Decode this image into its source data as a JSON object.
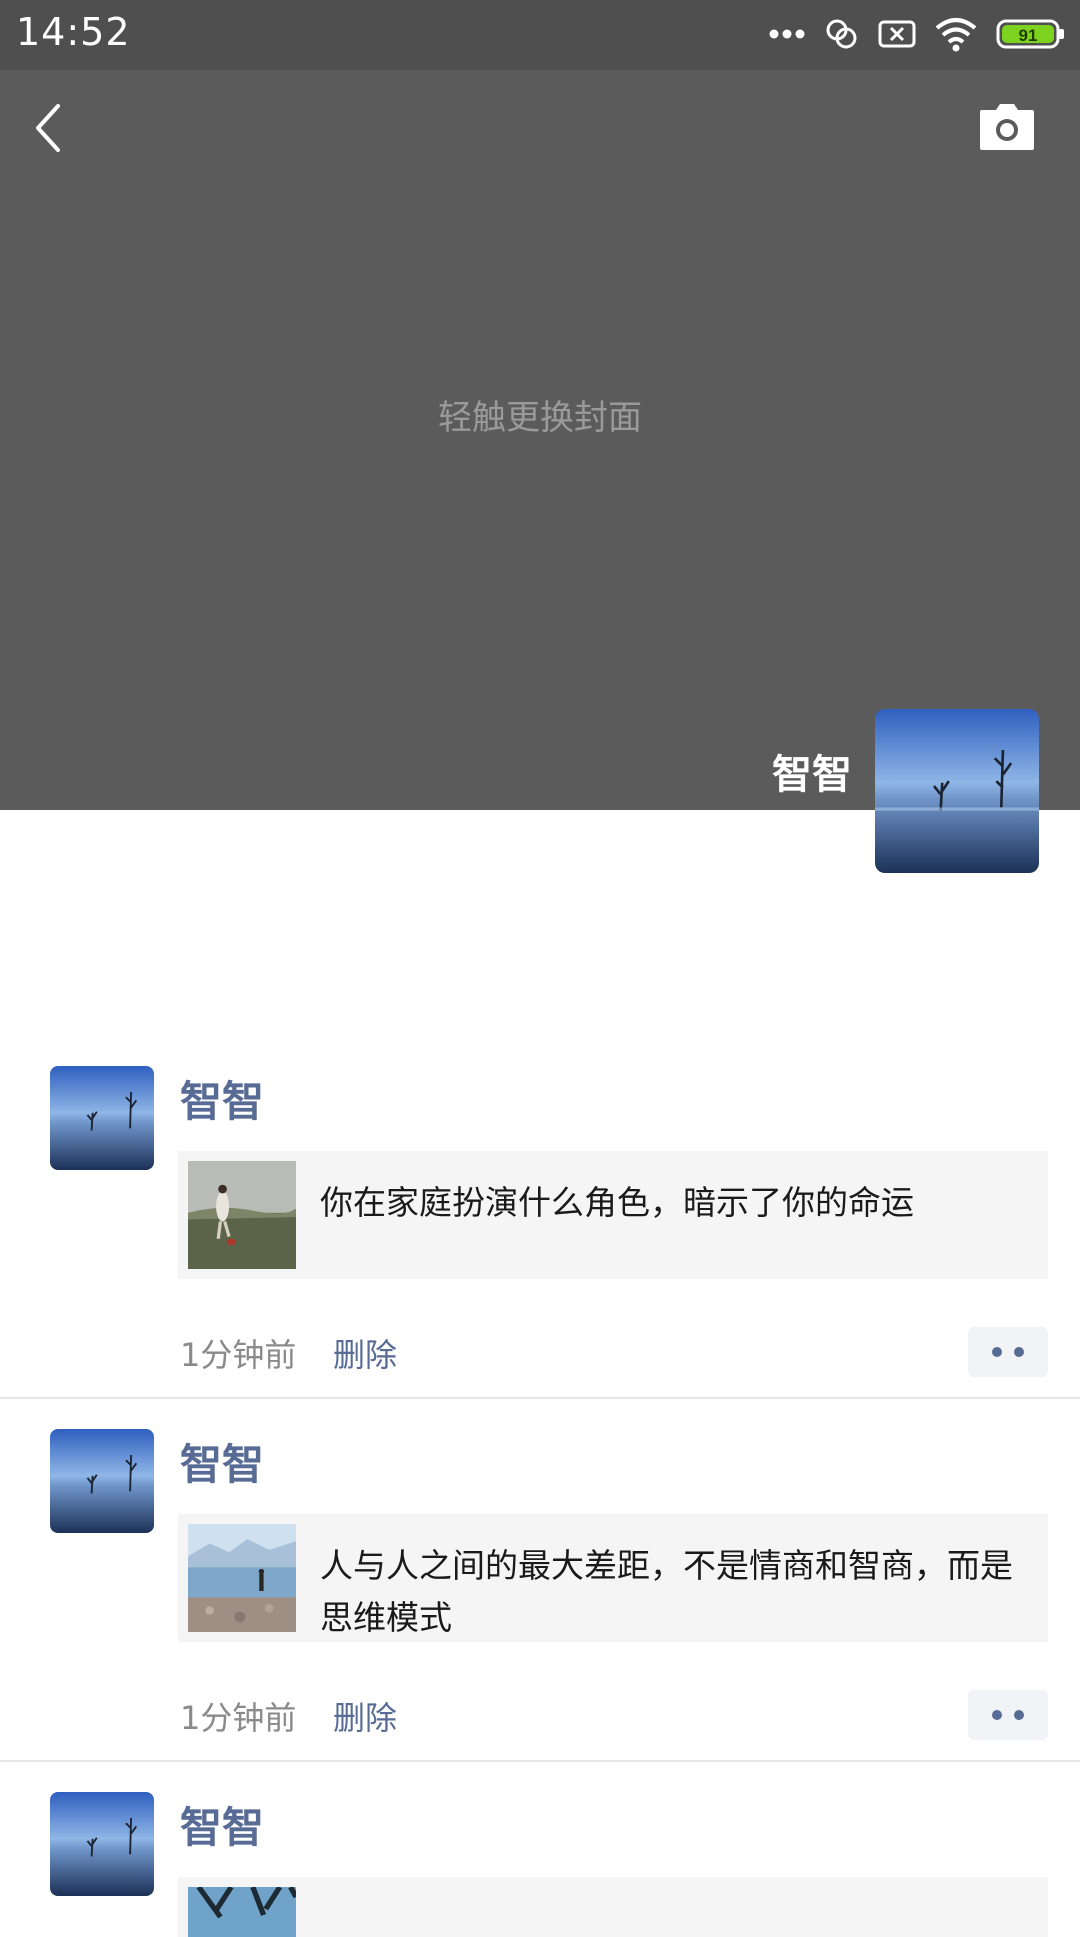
{
  "status_bar": {
    "time": "14:52",
    "battery": "91"
  },
  "header": {
    "cover_hint": "轻触更换封面",
    "profile_name": "智智"
  },
  "colors": {
    "cover": "#5b5b5b",
    "name_link": "#576b95",
    "card_bg": "#f5f5f5",
    "battery_green": "#7ed321"
  },
  "icons": {
    "back": "chevron-left-icon",
    "camera": "camera-icon",
    "more": "more-dots-icon"
  },
  "posts": [
    {
      "author": "智智",
      "link_title": "你在家庭扮演什么角色，暗示了你的命运",
      "time": "1分钟前",
      "delete_label": "删除"
    },
    {
      "author": "智智",
      "link_title": "人与人之间的最大差距，不是情商和智商，而是思维模式",
      "time": "1分钟前",
      "delete_label": "删除"
    },
    {
      "author": "智智"
    }
  ]
}
